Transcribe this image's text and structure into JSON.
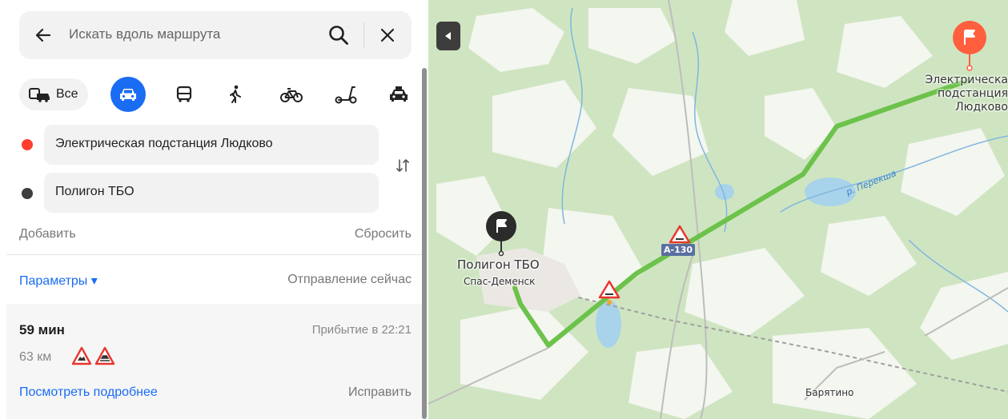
{
  "search": {
    "placeholder": "Искать вдоль маршрута"
  },
  "modes": {
    "all_label": "Все"
  },
  "waypoints": {
    "from": "Электрическая подстанция Людково",
    "to": "Полигон ТБО"
  },
  "actions": {
    "add": "Добавить",
    "reset": "Сбросить"
  },
  "options": {
    "params": "Параметры ▾",
    "departure": "Отправление сейчас"
  },
  "route": {
    "duration": "59 мин",
    "arrival": "Прибытие в 22:21",
    "distance": "63 км",
    "details_link": "Посмотреть подробнее",
    "fix_link": "Исправить"
  },
  "map": {
    "from_label": "Электрическая подстанция Людково",
    "from_label_lines": [
      "Электрическа",
      "подстанция",
      "Людково"
    ],
    "to_label": "Полигон ТБО",
    "town": "Спас-Деменск",
    "village": "Барятино",
    "river": "р. Перекша",
    "road_badge": "A-130"
  },
  "colors": {
    "accent": "#1a6cf3",
    "route": "#6cc24a",
    "start": "#ff5f3d",
    "finish": "#3e3e3e",
    "forest": "#cfe5c1"
  },
  "icons": [
    "back-arrow-icon",
    "search-icon",
    "close-icon",
    "car-icon",
    "bus-icon",
    "walk-icon",
    "bike-icon",
    "scooter-icon",
    "taxi-icon",
    "swap-icon",
    "warning-icon",
    "flag-icon"
  ]
}
